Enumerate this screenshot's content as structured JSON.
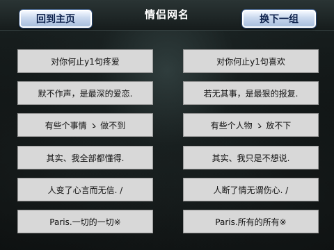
{
  "header": {
    "title": "情侣网名",
    "home_label": "回到主页",
    "next_label": "换下一组"
  },
  "names": [
    {
      "left": "对你何止y1句疼爱",
      "right": "对你何止y1句喜欢"
    },
    {
      "left": "默不作声，是最深的爱恋.",
      "right": "若无其事，是最狠的报复."
    },
    {
      "left": "有些个事情 ゝ 做不到",
      "right": "有些个人物 ゝ 放不下"
    },
    {
      "left": "其实、我全部都懂得.",
      "right": "其实、我只是不想说."
    },
    {
      "left": "人变了心言而无信. /",
      "right": "人断了情无谓伤心. /"
    },
    {
      "left": "Paris.一切的一切※",
      "right": "Paris.所有的所有※"
    }
  ]
}
